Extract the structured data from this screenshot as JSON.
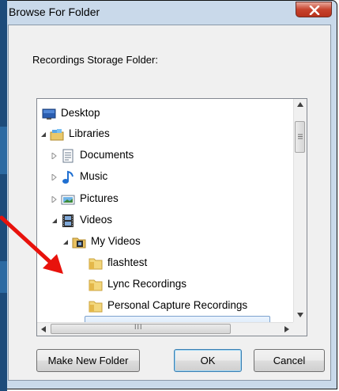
{
  "window": {
    "title": "Browse For Folder",
    "close_glyph": "x",
    "prompt": "Recordings Storage Folder:"
  },
  "tree": {
    "items": [
      {
        "label": "Desktop",
        "icon": "desktop-icon",
        "expander": "none"
      },
      {
        "label": "Libraries",
        "icon": "libraries-icon",
        "expander": "expanded"
      },
      {
        "label": "Documents",
        "icon": "documents-icon",
        "expander": "collapsed"
      },
      {
        "label": "Music",
        "icon": "music-icon",
        "expander": "collapsed"
      },
      {
        "label": "Pictures",
        "icon": "pictures-icon",
        "expander": "collapsed"
      },
      {
        "label": "Videos",
        "icon": "videos-icon",
        "expander": "expanded"
      },
      {
        "label": "My Videos",
        "icon": "my-videos-icon",
        "expander": "expanded"
      },
      {
        "label": "flashtest",
        "icon": "folder-icon",
        "expander": "none"
      },
      {
        "label": "Lync Recordings",
        "icon": "folder-icon",
        "expander": "none"
      },
      {
        "label": "Personal Capture Recordings",
        "icon": "folder-icon",
        "expander": "none",
        "selected": true
      }
    ],
    "hscroll_grip": "III"
  },
  "buttons": {
    "make_new_folder": "Make New Folder",
    "ok": "OK",
    "cancel": "Cancel"
  },
  "colors": {
    "selection": "#cfe4fb",
    "annotation_arrow": "#e8120c"
  }
}
